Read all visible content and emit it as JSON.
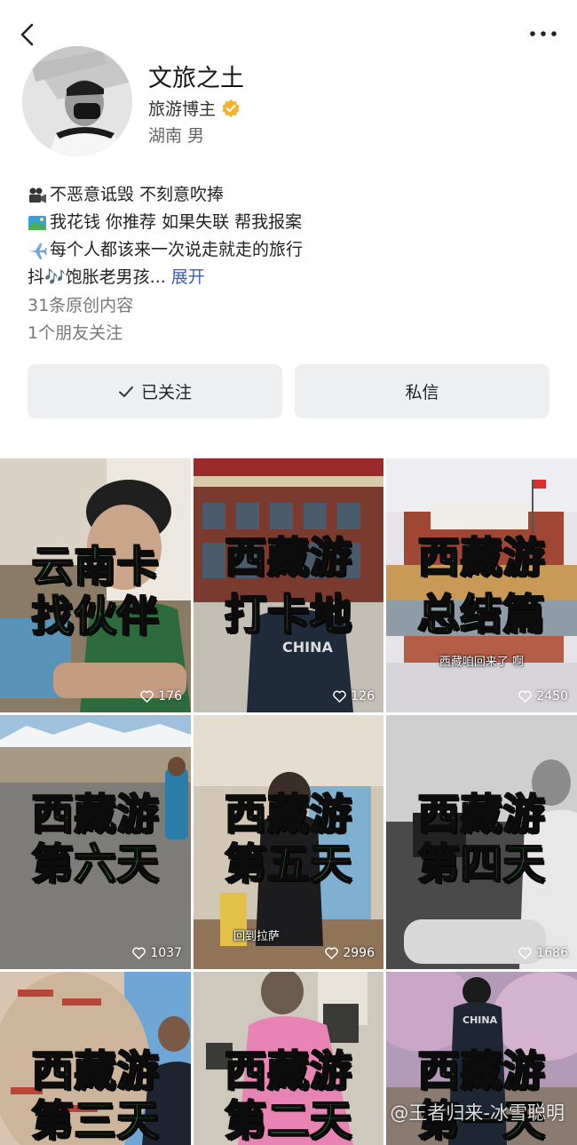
{
  "profile": {
    "name": "文旅之土",
    "role": "旅游博主",
    "location": "湖南 男"
  },
  "bio": {
    "line1": "不恶意诋毁 不刻意吹捧",
    "line2": "我花钱 你推荐 如果失联 帮我报案",
    "line3": "每个人都该来一次说走就走的旅行",
    "line4": "抖🎶饱胀老男孩...",
    "expand": "展开",
    "line1_icon": "movie-camera-icon",
    "line2_icon": "picture-icon",
    "line3_icon": "airplane-icon"
  },
  "stats": {
    "original": "31条原创内容",
    "friends": "1个朋友关注"
  },
  "buttons": {
    "follow": "已关注",
    "message": "私信"
  },
  "videos": [
    {
      "caption1": "云南卡",
      "caption2": "找伙伴",
      "likes": "176",
      "subtitle": ""
    },
    {
      "caption1": "西藏游",
      "caption2": "打卡地",
      "likes": "126",
      "subtitle": ""
    },
    {
      "caption1": "西藏游",
      "caption2": "总结篇",
      "likes": "2450",
      "subtitle": "西藏咱回来了 啊"
    },
    {
      "caption1": "西藏游",
      "caption2": "第六天",
      "likes": "1037",
      "subtitle": ""
    },
    {
      "caption1": "西藏游",
      "caption2": "第五天",
      "likes": "2996",
      "subtitle": "回到拉萨"
    },
    {
      "caption1": "西藏游",
      "caption2": "第四天",
      "likes": "1686",
      "subtitle": ""
    },
    {
      "caption1": "西藏游",
      "caption2": "第三天",
      "likes": "",
      "subtitle": ""
    },
    {
      "caption1": "西藏游",
      "caption2": "第二天",
      "likes": "",
      "subtitle": ""
    },
    {
      "caption1": "西藏游",
      "caption2": "第一天",
      "likes": "",
      "subtitle": ""
    }
  ],
  "watermark": "@王者归来-冰雪聪明",
  "colors": {
    "caption_green": "#5ee870",
    "link_blue": "#3d5ea8",
    "verified_gold": "#f2b32b",
    "button_bg": "#eeeff1"
  }
}
